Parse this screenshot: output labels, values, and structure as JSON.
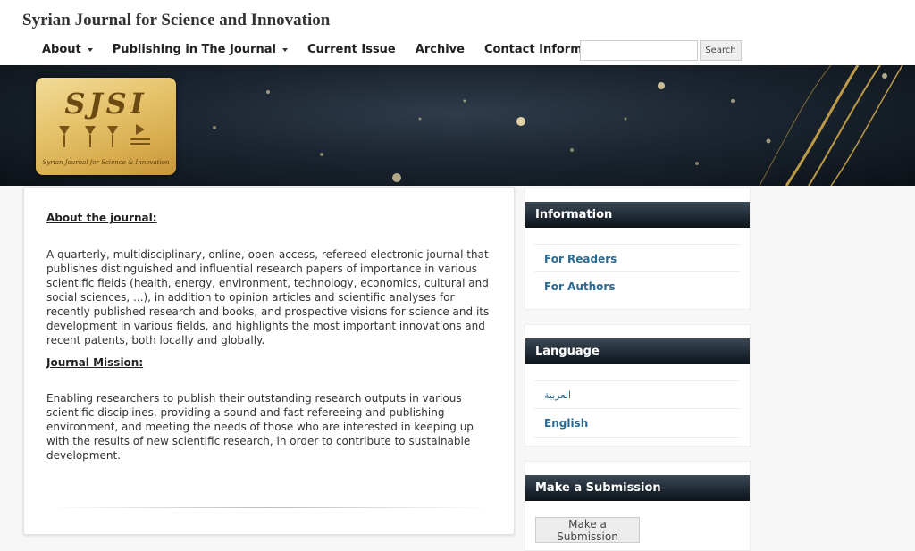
{
  "header": {
    "site_title": "Syrian Journal for Science and Innovation",
    "nav": [
      {
        "label": "About",
        "dropdown": true
      },
      {
        "label": "Publishing in The Journal",
        "dropdown": true
      },
      {
        "label": "Current Issue",
        "dropdown": false
      },
      {
        "label": "Archive",
        "dropdown": false
      },
      {
        "label": "Contact Information",
        "dropdown": false
      }
    ],
    "search": {
      "value": "",
      "button_label": "Search"
    }
  },
  "banner": {
    "logo_text": "SJSI",
    "logo_subtitle": "Syrian Journal for Science & Innovation"
  },
  "main": {
    "about_heading": "About the journal:",
    "about_text": "A quarterly, multidisciplinary, online, open-access, refereed electronic journal that publishes distinguished and influential research papers of importance in various scientific fields (health, energy, environment, technology, economics, cultural and social sciences, ...), in addition to opinion articles and scientific analyses for recently published research and books, and prospective visions for science and its development in various fields, and highlights the most important innovations and recent patents, both locally and globally.",
    "mission_heading": "Journal Mission:",
    "mission_text": "Enabling researchers to publish their outstanding research outputs in various scientific disciplines, providing a sound and fast refereeing and publishing environment, and meeting the needs of those who are interested in keeping up with the results of new scientific research, in order to contribute to sustainable development."
  },
  "sidebar": {
    "information": {
      "title": "Information",
      "links": [
        "For Readers",
        "For Authors"
      ]
    },
    "language": {
      "title": "Language",
      "links": [
        "العربية",
        "English"
      ]
    },
    "submission": {
      "title": "Make a Submission",
      "button_label": "Make a Submission"
    }
  },
  "colors": {
    "block_title_bg": "#1d2731",
    "link": "#2a6a92",
    "banner_bg": "#1b2530"
  }
}
